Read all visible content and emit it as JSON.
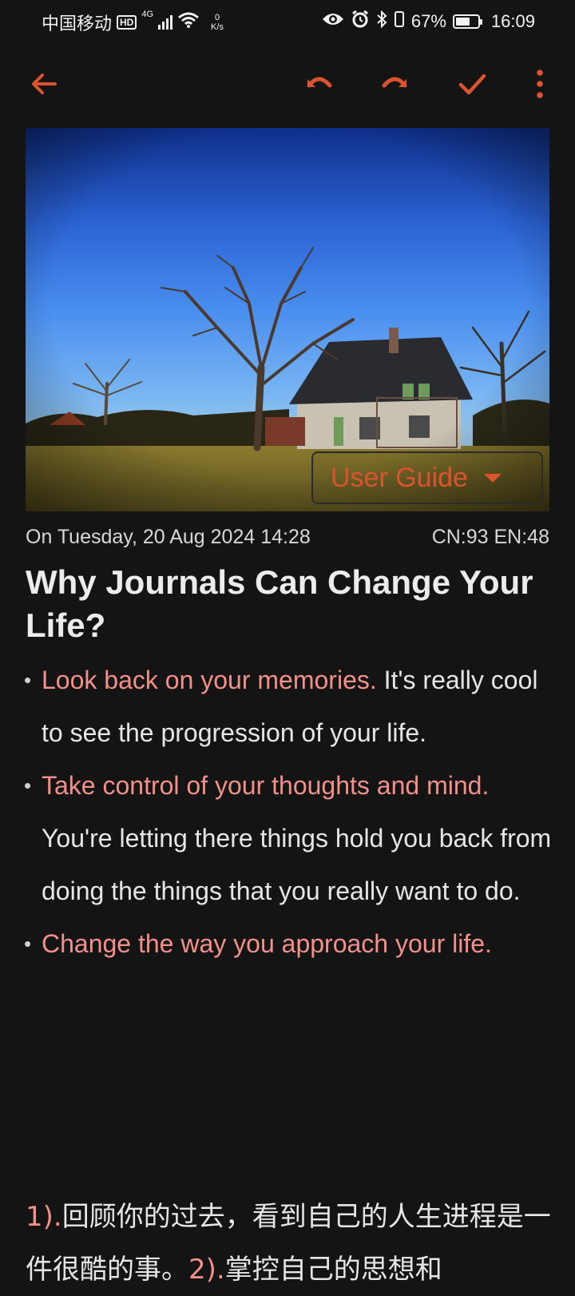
{
  "status_bar": {
    "carrier": "中国移动",
    "hd_badge": "HD",
    "network_type": "4G",
    "net_speed_value": "0",
    "net_speed_unit": "K/s",
    "battery_percent": "67%",
    "battery_level": 0.67,
    "time": "16:09"
  },
  "toolbar": {
    "back_icon": "arrow-left-icon",
    "undo_icon": "undo-icon",
    "redo_icon": "redo-icon",
    "save_icon": "check-icon",
    "more_icon": "more-vert-icon",
    "accent_color": "#d9542f"
  },
  "cover": {
    "guide_label": "User Guide",
    "guide_icon": "caret-down-icon"
  },
  "entry": {
    "date": "On Tuesday, 20 Aug 2024 14:28",
    "counts": "CN:93  EN:48",
    "title": "Why Journals Can Change Your Life?",
    "bullets": [
      {
        "highlight": "Look back on your memories.",
        "text": " It's really cool to see the progression of your life."
      },
      {
        "highlight": "Take control of your thoughts and mind.",
        "text": " You're letting there things hold you back from doing the things that you really want to do."
      },
      {
        "highlight": "Change the way you approach your life.",
        "text": ""
      }
    ],
    "cn_num1": "1).",
    "cn_text1": "回顾你的过去，看到自己的人生进程是一件很酷的事。",
    "cn_num2": "2).",
    "cn_text2": "掌控自己的思想和",
    "highlight_color": "#f2908a"
  }
}
